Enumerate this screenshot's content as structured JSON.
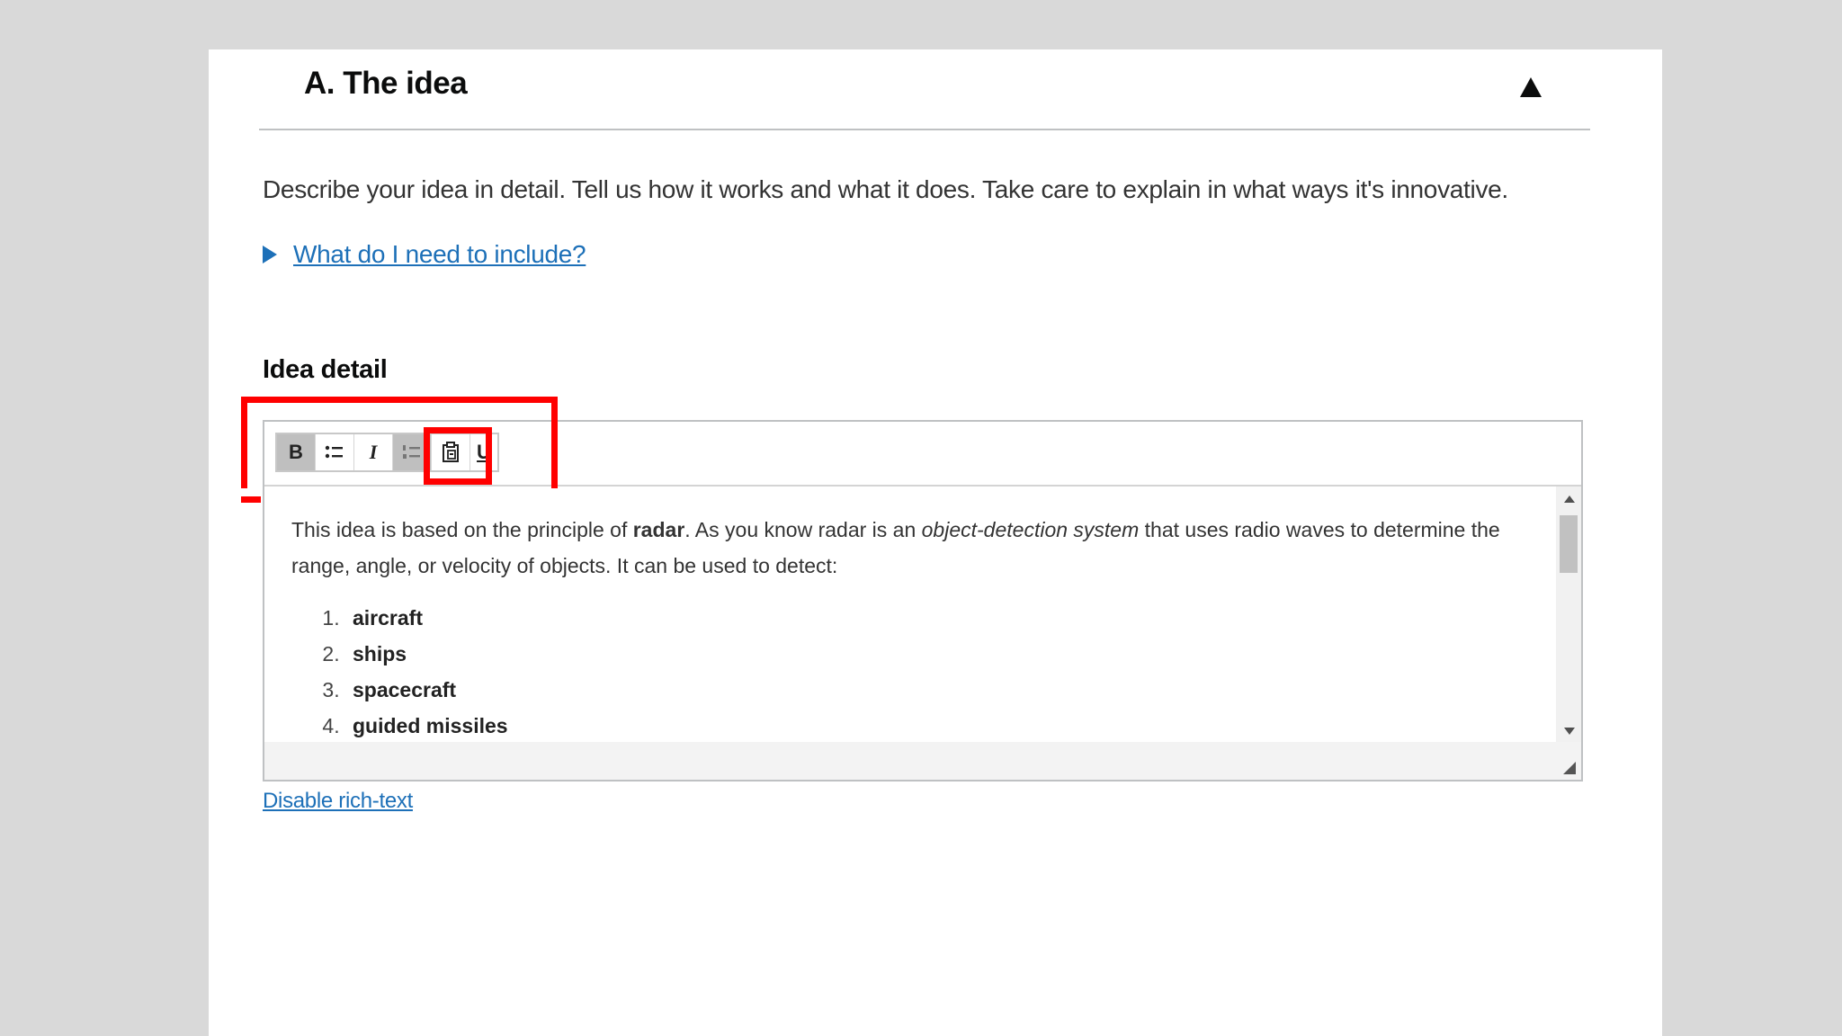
{
  "section": {
    "title": "A. The idea"
  },
  "intro": "Describe your idea in detail. Tell us how it works and what it does. Take care to explain in what ways it's innovative.",
  "details_link": "What do I need to include?",
  "field_label": "Idea detail",
  "toolbar": {
    "bold": "B",
    "bullets": "•≡",
    "italic": "I",
    "numbered": "1≡",
    "paste": "📋",
    "underline": "U"
  },
  "editor": {
    "p_before": "This idea is based on the principle of ",
    "p_bold": "radar",
    "p_mid": ". As you know radar is an ",
    "p_italic": "object-detection system",
    "p_after": " that uses radio waves to determine the range, angle, or velocity of objects. It can be used to detect:",
    "list": [
      "aircraft",
      "ships",
      "spacecraft",
      "guided missiles"
    ]
  },
  "disable_link": "Disable rich-text",
  "icons": [
    "triangle-up-icon",
    "triangle-right-icon",
    "bold-icon",
    "bulleted-list-icon",
    "italic-icon",
    "numbered-list-icon",
    "paste-icon",
    "underline-icon",
    "scroll-up-icon",
    "scroll-down-icon",
    "resize-handle-icon"
  ],
  "colors": {
    "link": "#1d70b8",
    "highlight": "#ff0000",
    "background": "#d9d9d9"
  }
}
